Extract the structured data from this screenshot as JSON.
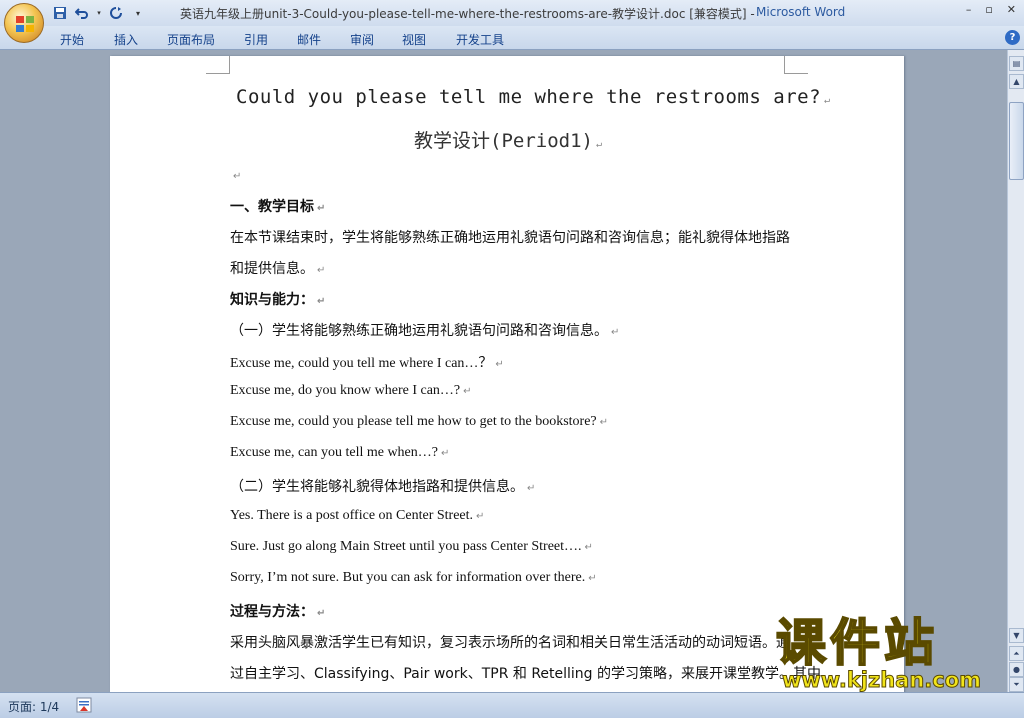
{
  "window": {
    "doc_title": "英语九年级上册unit-3-Could-you-please-tell-me-where-the-restrooms-are-教学设计.doc [兼容模式] - ",
    "app_name": "Microsoft Word",
    "controls": {
      "minimize": "–",
      "restore": "▫",
      "close": "✕"
    }
  },
  "ribbon": {
    "tabs": [
      "开始",
      "插入",
      "页面布局",
      "引用",
      "邮件",
      "审阅",
      "视图",
      "开发工具"
    ],
    "help": "?"
  },
  "document": {
    "title": "Could you please tell me where the restrooms are?",
    "subtitle": "教学设计(Period1)",
    "para_mark": "↵",
    "lines": [
      "一、教学目标",
      "在本节课结束时，学生将能够熟练正确地运用礼貌语句问路和咨询信息；能礼貌得体地指路",
      "和提供信息。",
      "知识与能力：",
      "（一）学生将能够熟练正确地运用礼貌语句问路和咨询信息。",
      "Excuse me, could you tell me where I can…？",
      "Excuse me, do you know where I can…?",
      "Excuse me, could you please tell me how to get to the bookstore?",
      "Excuse me, can you tell me when…?",
      "（二）学生将能够礼貌得体地指路和提供信息。",
      "Yes. There is a post office on Center Street.",
      "Sure. Just go along Main Street until you pass Center Street….",
      "Sorry, I’m not sure. But you can ask for information over there.",
      "过程与方法：",
      "采用头脑风暴激活学生已有知识，复习表示场所的名词和相关日常生活活动的动词短语。通",
      "过自主学习、Classifying、Pair work、TPR 和  Retelling 的学习策略，来展开课堂教学。其中"
    ]
  },
  "statusbar": {
    "page_indicator": "页面: 1/4"
  },
  "watermark": {
    "title": "课件站",
    "url": "www.kjzhan.com"
  }
}
